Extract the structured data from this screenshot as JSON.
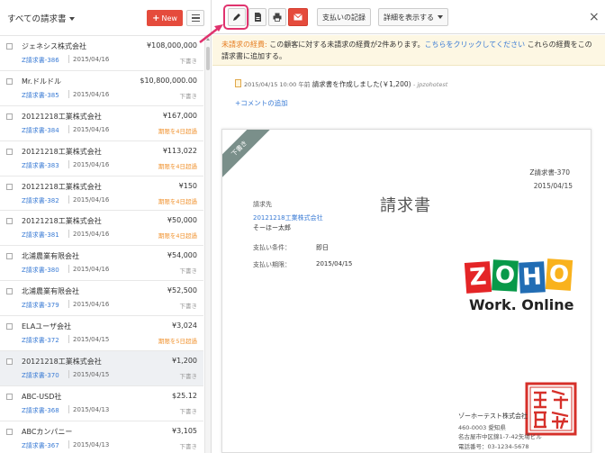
{
  "list": {
    "title": "すべての請求書",
    "new_label": "New",
    "rows": [
      {
        "customer": "ジェネシス株式会社",
        "amount": "¥108,000,000",
        "number": "Z請求書-386",
        "date": "2015/04/16",
        "status": "下書き",
        "overdue": false
      },
      {
        "customer": "Mr.ドルドル",
        "amount": "$10,800,000.00",
        "number": "Z請求書-385",
        "date": "2015/04/16",
        "status": "下書き",
        "overdue": false
      },
      {
        "customer": "20121218工業株式会社",
        "amount": "¥167,000",
        "number": "Z請求書-384",
        "date": "2015/04/16",
        "status": "期限を4日超過",
        "overdue": true
      },
      {
        "customer": "20121218工業株式会社",
        "amount": "¥113,022",
        "number": "Z請求書-383",
        "date": "2015/04/16",
        "status": "期限を4日超過",
        "overdue": true
      },
      {
        "customer": "20121218工業株式会社",
        "amount": "¥150",
        "number": "Z請求書-382",
        "date": "2015/04/16",
        "status": "期限を4日超過",
        "overdue": true
      },
      {
        "customer": "20121218工業株式会社",
        "amount": "¥50,000",
        "number": "Z請求書-381",
        "date": "2015/04/16",
        "status": "期限を4日超過",
        "overdue": true
      },
      {
        "customer": "北浦農業有限会社",
        "amount": "¥54,000",
        "number": "Z請求書-380",
        "date": "2015/04/16",
        "status": "下書き",
        "overdue": false
      },
      {
        "customer": "北浦農業有限会社",
        "amount": "¥52,500",
        "number": "Z請求書-379",
        "date": "2015/04/16",
        "status": "下書き",
        "overdue": false
      },
      {
        "customer": "ELAユーザ会社",
        "amount": "¥3,024",
        "number": "Z請求書-372",
        "date": "2015/04/15",
        "status": "期限を5日超過",
        "overdue": true
      },
      {
        "customer": "20121218工業株式会社",
        "amount": "¥1,200",
        "number": "Z請求書-370",
        "date": "2015/04/15",
        "status": "下書き",
        "overdue": false,
        "selected": true
      },
      {
        "customer": "ABC-USD社",
        "amount": "$25.12",
        "number": "Z請求書-368",
        "date": "2015/04/13",
        "status": "下書き",
        "overdue": false
      },
      {
        "customer": "ABCカンパニー",
        "amount": "¥3,105",
        "number": "Z請求書-367",
        "date": "2015/04/13",
        "status": "下書き",
        "overdue": false
      }
    ]
  },
  "toolbar": {
    "payment_record_label": "支払いの記録",
    "more_details_label": "詳細を表示する",
    "icons": [
      "pencil-icon",
      "pdf-icon",
      "printer-icon",
      "mail-icon",
      "close-icon"
    ]
  },
  "alert": {
    "prefix": "未請求の経費:",
    "text": "この顧客に対する未請求の経費が2件あります。",
    "link": "こちらをクリックしてください",
    "suffix": "これらの経費をこの請求書に追加する。"
  },
  "activity": {
    "time": "2015/04/15 10:00 午前",
    "text": "請求書を作成しました(￥1,200)",
    "user": "- jpzohotest",
    "add_comment": "+コメントの追加"
  },
  "invoice": {
    "ribbon": "下書き",
    "number": "Z請求書-370",
    "date": "2015/04/15",
    "title": "請求書",
    "bill_to_label": "請求先",
    "bill_to_company": "20121218工業株式会社",
    "bill_to_person": "そーほー太郎",
    "terms_label": "支払い条件：",
    "terms_value": "即日",
    "due_label": "支払い期限：",
    "due_value": "2015/04/15",
    "logo_text": "ZOHO",
    "logo_tagline": "Work. Online",
    "company_name": "ゾーホーテスト株式会社",
    "company_zip": "460-0003 愛知県",
    "company_address": "名古屋市中区錦1-7-42矢場ビル",
    "company_tel": "電話番号：03-1234-5678",
    "seal_text": "株ゾーホーテスト式会社"
  },
  "colors": {
    "accent_red": "#e54b3c",
    "highlight_pink": "#e0336e",
    "link_blue": "#3a7bd5",
    "overdue_orange": "#f0912c",
    "zoho_red": "#e42527",
    "zoho_green": "#089949",
    "zoho_blue": "#226db4",
    "zoho_yellow": "#f9b21d"
  }
}
